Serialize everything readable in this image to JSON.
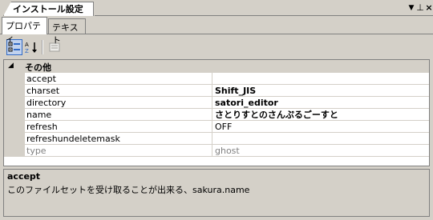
{
  "window": {
    "title": "インストール設定",
    "buttons": {
      "dropdown": "▼",
      "pin": "⊥",
      "close": "×"
    }
  },
  "tabs": [
    {
      "label": "プロパティ",
      "active": true
    },
    {
      "label": "テキスト",
      "active": false
    }
  ],
  "toolbar": {
    "categorized": "categorized-icon",
    "alphabetical": "sort-az-icon",
    "property_pages": "property-pages-icon"
  },
  "grid": {
    "category": {
      "label": "その他",
      "expanded": true
    },
    "rows": [
      {
        "name": "accept",
        "value": ""
      },
      {
        "name": "charset",
        "value": " Shift_JIS"
      },
      {
        "name": "directory",
        "value": "satori_editor"
      },
      {
        "name": "name",
        "value": "さとりすとのさんぷるごーすと"
      },
      {
        "name": "refresh",
        "value": "OFF"
      },
      {
        "name": "refreshundeletemask",
        "value": ""
      },
      {
        "name": "type",
        "value": "ghost",
        "disabled": true
      }
    ]
  },
  "description": {
    "title": "accept",
    "text": "このファイルセットを受け取ることが出来る、sakura.name"
  }
}
